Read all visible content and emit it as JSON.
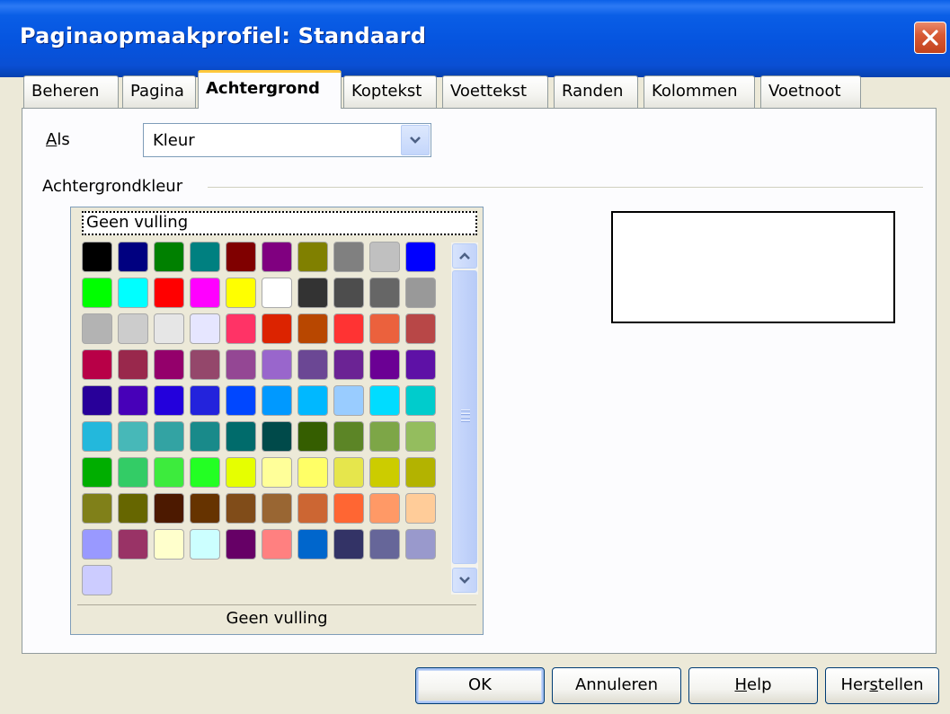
{
  "window": {
    "title": "Paginaopmaakprofiel: Standaard"
  },
  "tabs": [
    {
      "label": "Beheren",
      "active": false
    },
    {
      "label": "Pagina",
      "active": false
    },
    {
      "label": "Achtergrond",
      "active": true
    },
    {
      "label": "Koptekst",
      "active": false
    },
    {
      "label": "Voettekst",
      "active": false
    },
    {
      "label": "Randen",
      "active": false
    },
    {
      "label": "Kolommen",
      "active": false
    },
    {
      "label": "Voetnoot",
      "active": false
    }
  ],
  "als": {
    "label_mnemonic": "A",
    "label_rest": "ls",
    "selected": "Kleur"
  },
  "background": {
    "group_title": "Achtergrondkleur",
    "none_item": "Geen vulling",
    "preview_label": "Geen vulling",
    "colors": [
      "#000000",
      "#000080",
      "#008000",
      "#008080",
      "#800000",
      "#800080",
      "#808000",
      "#808080",
      "#c0c0c0",
      "#0000ff",
      "#00ff00",
      "#00ffff",
      "#ff0000",
      "#ff00ff",
      "#ffff00",
      "#ffffff",
      "#333333",
      "#4d4d4d",
      "#666666",
      "#999999",
      "#b3b3b3",
      "#cccccc",
      "#e6e6e6",
      "#e6e6ff",
      "#ff3366",
      "#dc2300",
      "#b84700",
      "#ff3333",
      "#eb613d",
      "#b84747",
      "#b80047",
      "#99284c",
      "#94006b",
      "#94476b",
      "#944794",
      "#9966cc",
      "#6b4794",
      "#6b2394",
      "#6b0094",
      "#5e11a6",
      "#280099",
      "#4700b8",
      "#2300dc",
      "#2323dc",
      "#0047ff",
      "#0099ff",
      "#00b8ff",
      "#99ccff",
      "#00dcff",
      "#00cccc",
      "#23b8dc",
      "#47b8b8",
      "#33a3a3",
      "#198a8a",
      "#006b6b",
      "#004a4a",
      "#355e00",
      "#5c8526",
      "#7da647",
      "#94bd5e",
      "#00ae00",
      "#33cc66",
      "#3deb3d",
      "#23ff23",
      "#e6ff00",
      "#ffff99",
      "#ffff66",
      "#e6e64c",
      "#cccc00",
      "#b3b300",
      "#808019",
      "#666600",
      "#4c1900",
      "#663300",
      "#804c19",
      "#996633",
      "#cc6633",
      "#ff6633",
      "#ff9966",
      "#ffcc99",
      "#9999ff",
      "#993366",
      "#ffffcc",
      "#ccffff",
      "#660066",
      "#ff8080",
      "#0066cc",
      "#333366",
      "#666699",
      "#9999cc",
      "#ccccff"
    ]
  },
  "buttons": {
    "ok": "OK",
    "cancel": "Annuleren",
    "help_mnemonic": "H",
    "help_rest": "elp",
    "reset_pre": "Her",
    "reset_mnemonic": "s",
    "reset_rest": "tellen"
  }
}
